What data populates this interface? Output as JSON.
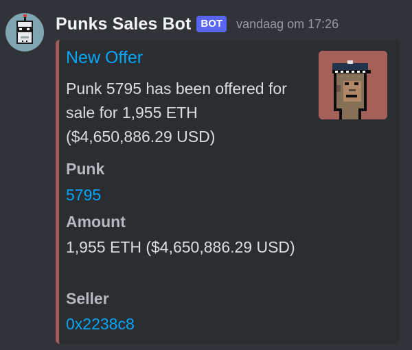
{
  "message": {
    "username": "Punks Sales Bot",
    "bot_tag": "BOT",
    "timestamp": "vandaag om 17:26"
  },
  "embed": {
    "accent_color": "#a45d58",
    "title": "New Offer",
    "description": "Punk 5795 has been offered for sale for 1,955 ETH ($4,650,886.29 USD)",
    "thumbnail_icon": "cryptopunk-5795-image",
    "fields": [
      {
        "name": "Punk",
        "value": "5795"
      },
      {
        "name": "Amount",
        "value": "1,955 ETH ($4,650,886.29 USD)"
      },
      {
        "name": "Seller",
        "value": "0x2238c8"
      }
    ]
  },
  "colors": {
    "background": "#313338",
    "embed_background": "#2b2d31",
    "link": "#00a8fc",
    "bot_tag": "#5865f2"
  }
}
